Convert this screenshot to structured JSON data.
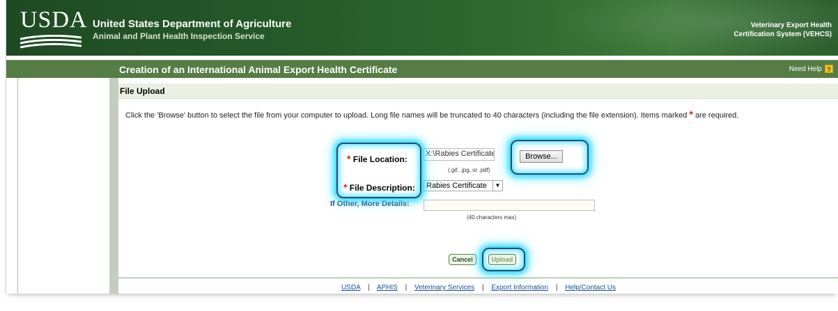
{
  "header": {
    "logo_text": "USDA",
    "agency_name": "United States Department of Agriculture",
    "agency_sub": "Animal and Plant Health Inspection Service",
    "system_line1": "Veterinary Export Health",
    "system_line2": "Certification System (VEHCS)"
  },
  "titlebar": {
    "title": "Creation of an International Animal Export Health Certificate",
    "help_label": "Need Help",
    "help_icon": "?"
  },
  "section": {
    "heading": "File Upload",
    "instructions_pre": "Click the 'Browse' button to select the file from your computer to upload. Long file names will be truncated to 40 characters (including the file extension). Items marked",
    "required_marker": "*",
    "instructions_post": "are required."
  },
  "form": {
    "file_location_label": "File Location:",
    "file_location_value": "X:\\Rabies Certificate.pdf",
    "browse_label": "Browse...",
    "file_types_hint": "(.gif, .jpg, or .pdf)",
    "file_description_label": "File Description:",
    "file_description_value": "Rabies Certificate",
    "other_details_label": "If Other, More Details:",
    "other_details_value": "",
    "max_hint": "(40 characters max)",
    "cancel_label": "Cancel",
    "upload_label": "Upload"
  },
  "footer": {
    "links": [
      "USDA",
      "APHIS",
      "Veterinary Services",
      "Export Information",
      "Help/Contact Us"
    ],
    "separator": "|"
  },
  "colors": {
    "header_green": "#255a2a",
    "titlebar_green": "#557d45",
    "required_red": "#e11b1b",
    "highlight_cyan": "#00d2ff",
    "link_blue": "#1b4b99"
  }
}
